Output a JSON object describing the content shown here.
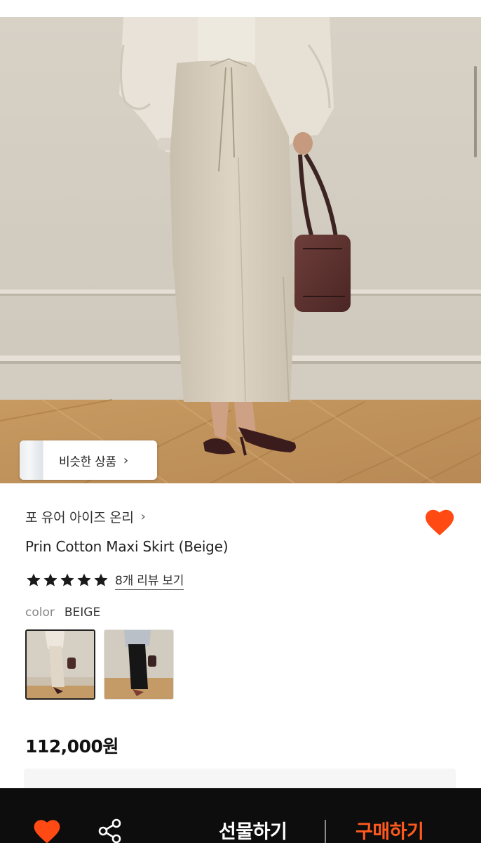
{
  "hero": {
    "similar_button_label": "비슷한 상품",
    "similar_button_chevron": "›"
  },
  "product": {
    "brand": "포 유어 아이즈 온리",
    "brand_chevron": "›",
    "title": "Prin Cotton Maxi Skirt (Beige)",
    "rating": 5,
    "rating_max": 5,
    "review_link": "8개 리뷰 보기",
    "color_label": "color",
    "color_value": "BEIGE",
    "swatches": [
      {
        "name": "beige",
        "selected": true
      },
      {
        "name": "black",
        "selected": false
      }
    ],
    "price": "112,000원",
    "wishlisted": true
  },
  "bottom_bar": {
    "gift_label": "선물하기",
    "buy_label": "구매하기"
  },
  "colors": {
    "accent": "#ff5a1e",
    "heart": "#ff4a14",
    "bar_background": "#0d0d0d"
  },
  "icons": {
    "wishlist": "heart-icon",
    "share": "share-icon",
    "rating": "star-icon",
    "chevron": "chevron-right-icon"
  }
}
